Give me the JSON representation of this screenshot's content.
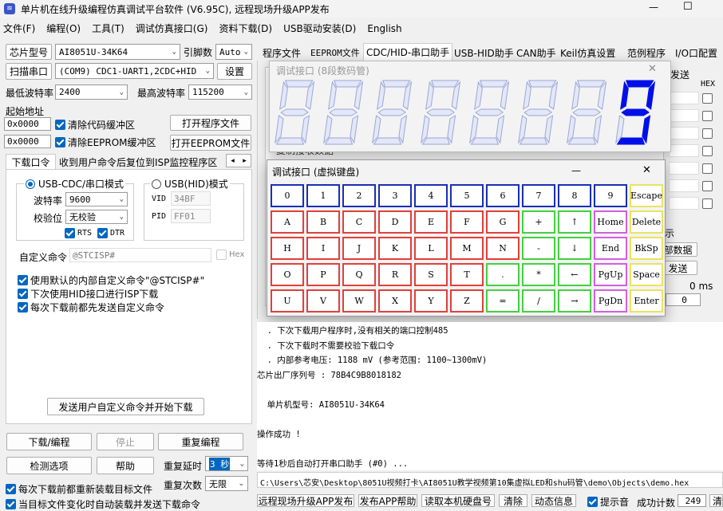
{
  "window": {
    "title": "单片机在线升级编程仿真调试平台软件 (V6.95C), 远程现场升级APP发布",
    "min": "—",
    "max": "☐",
    "close": "✕"
  },
  "menu": [
    "文件(F)",
    "编程(O)",
    "工具(T)",
    "调试仿真接口(G)",
    "资料下载(D)",
    "USB驱动安装(D)",
    "English"
  ],
  "left": {
    "mcu_type_btn": "芯片型号",
    "mcu_type": "AI8051U-34K64",
    "pins_label": "引脚数",
    "pins": "Auto",
    "scan_btn": "扫描串口",
    "port": "(COM9) CDC1-UART1,2CDC+HID",
    "settings_btn": "设置",
    "min_baud_label": "最低波特率",
    "min_baud": "2400",
    "max_baud_label": "最高波特率",
    "max_baud": "115200",
    "start_addr_label": "起始地址",
    "addr1": "0x0000",
    "clear_code": "清除代码缓冲区",
    "open_prog": "打开程序文件",
    "addr2": "0x0000",
    "clear_eeprom": "清除EEPROM缓冲区",
    "open_eeprom": "打开EEPROM文件",
    "tabs": [
      "下载口令",
      "收到用户命令后复位到ISP监控程序区"
    ],
    "cdc_mode": "USB-CDC/串口模式",
    "hid_mode": "USB(HID)模式",
    "baud_label": "波特率",
    "baud": "9600",
    "parity_label": "校验位",
    "parity": "无校验",
    "rts": "RTS",
    "dtr": "DTR",
    "vid_label": "VID",
    "vid": "34BF",
    "pid_label": "PID",
    "pid": "FF01",
    "custom_cmd_label": "自定义命令",
    "custom_cmd": "@STCISP#",
    "hex": "Hex",
    "opt1": "使用默认的内部自定义命令\"@STCISP#\"",
    "opt2": "下次使用HID接口进行ISP下载",
    "opt3": "每次下载前都先发送自定义命令",
    "send_btn": "发送用户自定义命令并开始下载",
    "download_btn": "下载/编程",
    "stop_btn": "停止",
    "reprogram_btn": "重复编程",
    "check_btn": "检测选项",
    "help_btn": "帮助",
    "delay_label": "重复延时",
    "delay": "3 秒",
    "reload_label": "每次下载前都重新装载目标文件",
    "count_label": "重复次数",
    "count": "无限",
    "auto_load": "当目标文件变化时自动装载并发送下载命令"
  },
  "right_tabs": [
    "程序文件",
    "EEPROM文件",
    "CDC/HID-串口助手",
    "USB-HID助手",
    "CAN助手",
    "Keil仿真设置",
    "范例程序",
    "I/O口配置"
  ],
  "right_panel": {
    "send_label": "发送",
    "hex_label": "HEX",
    "partial1": "示",
    "partial2": "部数据",
    "partial3": "发送",
    "ms": "0 ms",
    "zero": "0",
    "recv_data": "复制接收数据"
  },
  "seg_win": {
    "title": "调试接口 (8段数码管)",
    "digits": [
      "8",
      "8",
      "8",
      "8",
      "8",
      "8",
      "8",
      "9"
    ],
    "lit_digit": "9"
  },
  "kb_win": {
    "title": "调试接口 (虚拟键盘)",
    "rows": [
      [
        {
          "k": "0",
          "c": "kb"
        },
        {
          "k": "1",
          "c": "kb"
        },
        {
          "k": "2",
          "c": "kb"
        },
        {
          "k": "3",
          "c": "kb"
        },
        {
          "k": "4",
          "c": "kb"
        },
        {
          "k": "5",
          "c": "kb"
        },
        {
          "k": "6",
          "c": "kb"
        },
        {
          "k": "7",
          "c": "kb"
        },
        {
          "k": "8",
          "c": "kb"
        },
        {
          "k": "9",
          "c": "kb"
        },
        {
          "k": "Escape",
          "c": "ky"
        }
      ],
      [
        {
          "k": "A",
          "c": "kr"
        },
        {
          "k": "B",
          "c": "kr"
        },
        {
          "k": "C",
          "c": "kr"
        },
        {
          "k": "D",
          "c": "kr"
        },
        {
          "k": "E",
          "c": "kr"
        },
        {
          "k": "F",
          "c": "kr"
        },
        {
          "k": "G",
          "c": "kr"
        },
        {
          "k": "+",
          "c": "kg"
        },
        {
          "k": "↑",
          "c": "kg"
        },
        {
          "k": "Home",
          "c": "km"
        },
        {
          "k": "Delete",
          "c": "ky"
        }
      ],
      [
        {
          "k": "H",
          "c": "kr"
        },
        {
          "k": "I",
          "c": "kr"
        },
        {
          "k": "J",
          "c": "kr"
        },
        {
          "k": "K",
          "c": "kr"
        },
        {
          "k": "L",
          "c": "kr"
        },
        {
          "k": "M",
          "c": "kr"
        },
        {
          "k": "N",
          "c": "kr"
        },
        {
          "k": "-",
          "c": "kg"
        },
        {
          "k": "↓",
          "c": "kg"
        },
        {
          "k": "End",
          "c": "km"
        },
        {
          "k": "BkSp",
          "c": "ky"
        }
      ],
      [
        {
          "k": "O",
          "c": "kr"
        },
        {
          "k": "P",
          "c": "kr"
        },
        {
          "k": "Q",
          "c": "kr"
        },
        {
          "k": "R",
          "c": "kr"
        },
        {
          "k": "S",
          "c": "kr"
        },
        {
          "k": "T",
          "c": "kr"
        },
        {
          "k": ".",
          "c": "kg"
        },
        {
          "k": "*",
          "c": "kg"
        },
        {
          "k": "←",
          "c": "kg"
        },
        {
          "k": "PgUp",
          "c": "km"
        },
        {
          "k": "Space",
          "c": "ky"
        }
      ],
      [
        {
          "k": "U",
          "c": "kr"
        },
        {
          "k": "V",
          "c": "kr"
        },
        {
          "k": "W",
          "c": "kr"
        },
        {
          "k": "X",
          "c": "kr"
        },
        {
          "k": "Y",
          "c": "kr"
        },
        {
          "k": "Z",
          "c": "kr"
        },
        {
          "k": "=",
          "c": "kg"
        },
        {
          "k": "/",
          "c": "kg"
        },
        {
          "k": "→",
          "c": "kg"
        },
        {
          "k": "PgDn",
          "c": "km"
        },
        {
          "k": "Enter",
          "c": "ky"
        }
      ]
    ]
  },
  "output": [
    "  . 下次下载用户程序时,没有相关的端口控制485",
    "  . 下次下载时不需要校验下载口令",
    "  . 内部参考电压: 1188 mV (参考范围: 1100~1300mV)",
    "芯片出厂序列号 : 78B4C9B8018182",
    "",
    "  单片机型号: AI8051U-34K64",
    "",
    "操作成功 !",
    "",
    "等待1秒后自动打开串口助手 (#0) ..."
  ],
  "path": "C:\\Users\\芯安\\Desktop\\8051U视频打卡\\AI8051U教学视频第10集虚拟LED和shu码管\\demo\\Objects\\demo.hex",
  "status": {
    "remote": "远程现场升级APP发布",
    "help": "发布APP帮助",
    "read_disk": "读取本机硬盘号",
    "clear": "清除",
    "dynamic": "动态信息",
    "beep": "提示音",
    "success_label": "成功计数",
    "success": "249",
    "clear2": "清零"
  }
}
